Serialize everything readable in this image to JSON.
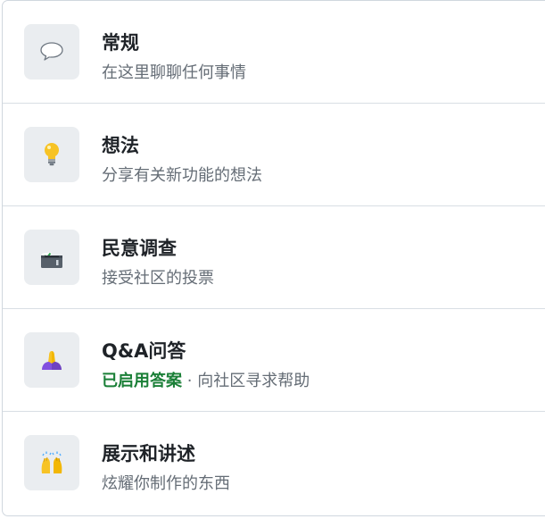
{
  "categories": [
    {
      "icon": "speech-bubble-icon",
      "title": "常规",
      "description": "在这里聊聊任何事情"
    },
    {
      "icon": "light-bulb-icon",
      "title": "想法",
      "description": "分享有关新功能的想法"
    },
    {
      "icon": "ballot-box-icon",
      "title": "民意调查",
      "description": "接受社区的投票"
    },
    {
      "icon": "praying-hands-icon",
      "title": "Q&A问答",
      "answers_badge": "已启用答案",
      "separator": "·",
      "description": "向社区寻求帮助"
    },
    {
      "icon": "raising-hands-icon",
      "title": "展示和讲述",
      "description": "炫耀你制作的东西"
    }
  ],
  "colors": {
    "badge_green": "#1a7f37",
    "title": "#1f2328",
    "muted": "#656d76",
    "icon_bg": "#eaedf0"
  }
}
